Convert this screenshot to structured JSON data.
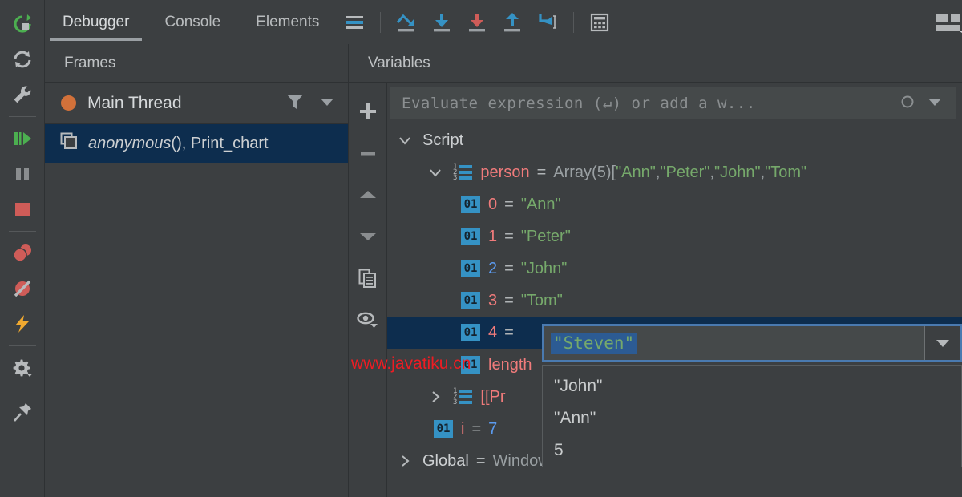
{
  "window": {
    "background": "#3c3f41",
    "accent": "#3592c4",
    "selection_bg": "#0d2d4e",
    "string_color": "#76a96b",
    "property_color": "#f07b7b",
    "number_color": "#5b9bf0"
  },
  "rail": {
    "items": [
      {
        "name": "rerun-icon",
        "label": "Rerun"
      },
      {
        "name": "restart-icon",
        "label": "Restart Frame"
      },
      {
        "name": "wrench-icon",
        "label": "Settings"
      },
      {
        "name": "resume-icon",
        "label": "Resume Program"
      },
      {
        "name": "pause-icon",
        "label": "Pause Program"
      },
      {
        "name": "stop-icon",
        "label": "Stop"
      },
      {
        "name": "view-breakpoints-icon",
        "label": "View Breakpoints"
      },
      {
        "name": "mute-breakpoints-icon",
        "label": "Mute Breakpoints"
      },
      {
        "name": "evaluate-expression-icon",
        "label": "Evaluate Expression"
      },
      {
        "name": "settings-gear-icon",
        "label": "Settings"
      },
      {
        "name": "pin-icon",
        "label": "Pin Tab"
      }
    ]
  },
  "tabs": [
    {
      "label": "Debugger",
      "active": true
    },
    {
      "label": "Console",
      "active": false
    },
    {
      "label": "Elements",
      "active": false
    }
  ],
  "toolbar": {
    "buttons": [
      {
        "name": "show-execution-point-icon",
        "label": "Show Execution Point"
      },
      {
        "name": "step-over-icon",
        "label": "Step Over"
      },
      {
        "name": "step-into-icon",
        "label": "Step Into"
      },
      {
        "name": "force-step-into-icon",
        "label": "Force Step Into"
      },
      {
        "name": "step-out-icon",
        "label": "Step Out"
      },
      {
        "name": "run-to-cursor-icon",
        "label": "Run to Cursor"
      },
      {
        "name": "evaluate-calculator-icon",
        "label": "Evaluate Expression"
      }
    ],
    "layout_button": {
      "name": "layout-settings-icon",
      "label": "Layout Settings"
    }
  },
  "frames": {
    "title": "Frames",
    "thread": {
      "name": "Main Thread",
      "status_color": "#d2713a",
      "filter_icon": "filter-icon",
      "dropdown_icon": "chevron-down-icon"
    },
    "stack": [
      {
        "icon": "frame-icon",
        "function": "anonymous",
        "suffix": "(), Print_chart",
        "selected": true
      }
    ]
  },
  "variables": {
    "title": "Variables",
    "toolbar": [
      {
        "name": "add-watch-button",
        "label": "+"
      },
      {
        "name": "remove-watch-button",
        "label": "−"
      },
      {
        "name": "move-up-button",
        "label": "Up"
      },
      {
        "name": "move-down-button",
        "label": "Down"
      },
      {
        "name": "copy-value-button",
        "label": "Copy Value"
      },
      {
        "name": "inspect-button",
        "label": "Inspect"
      }
    ],
    "evaluate": {
      "placeholder": "Evaluate expression (↵) or add a w...",
      "value": "",
      "history_icon": "history-icon",
      "dropdown_icon": "chevron-down-icon"
    },
    "tree": [
      {
        "indent": 0,
        "twisty": "expanded",
        "icon": "none",
        "name": "Script",
        "name_style": "plain",
        "eq": false,
        "value": "",
        "value_style": "none",
        "selected": false
      },
      {
        "indent": 1,
        "twisty": "expanded",
        "icon": "array",
        "name": "person",
        "name_style": "prop",
        "eq": true,
        "value": "Array(5) [\"Ann\", \"Peter\", \"John\", \"Tom\"",
        "value_style": "mixed-array",
        "selected": false
      },
      {
        "indent": 2,
        "twisty": "none",
        "icon": "01",
        "name": "0",
        "name_style": "prop",
        "eq": true,
        "value": "\"Ann\"",
        "value_style": "string",
        "selected": false
      },
      {
        "indent": 2,
        "twisty": "none",
        "icon": "01",
        "name": "1",
        "name_style": "prop",
        "eq": true,
        "value": "\"Peter\"",
        "value_style": "string",
        "selected": false
      },
      {
        "indent": 2,
        "twisty": "none",
        "icon": "01",
        "name": "2",
        "name_style": "num",
        "eq": true,
        "value": "\"John\"",
        "value_style": "string",
        "selected": false
      },
      {
        "indent": 2,
        "twisty": "none",
        "icon": "01",
        "name": "3",
        "name_style": "prop",
        "eq": true,
        "value": "\"Tom\"",
        "value_style": "string",
        "selected": false
      },
      {
        "indent": 2,
        "twisty": "none",
        "icon": "01",
        "name": "4",
        "name_style": "prop",
        "eq": true,
        "value": "",
        "value_style": "editing",
        "selected": true
      },
      {
        "indent": 2,
        "twisty": "none",
        "icon": "01",
        "name": "length",
        "name_style": "prop",
        "eq": false,
        "value": "",
        "value_style": "none",
        "selected": false
      },
      {
        "indent": 2,
        "twisty": "collapsed",
        "icon": "array",
        "name": "[[Pr",
        "name_style": "prop",
        "eq": false,
        "value": "",
        "value_style": "none",
        "selected": false
      },
      {
        "indent": 2,
        "twisty": "none",
        "icon": "01",
        "name": "i",
        "name_style": "prop",
        "eq": true,
        "value": "7",
        "value_style": "number",
        "selected": false
      },
      {
        "indent": 0,
        "twisty": "collapsed",
        "icon": "none",
        "name": "Global",
        "name_style": "plain",
        "eq": true,
        "value": "Window",
        "value_style": "dim",
        "selected": false
      }
    ],
    "array_preview": {
      "prefix": "Array(5) ",
      "open": "[",
      "items": [
        "\"Ann\"",
        "\"Peter\"",
        "\"John\"",
        "\"Tom\""
      ]
    },
    "value_editor": {
      "value": "\"Steven\"",
      "selected_text": true,
      "dropdown_icon": "chevron-down-icon"
    },
    "suggestions": [
      {
        "label": "\"John\""
      },
      {
        "label": "\"Ann\""
      },
      {
        "label": "5"
      }
    ]
  },
  "watermark": {
    "text": "www.javatiku.cn",
    "color": "#ee1c23"
  }
}
